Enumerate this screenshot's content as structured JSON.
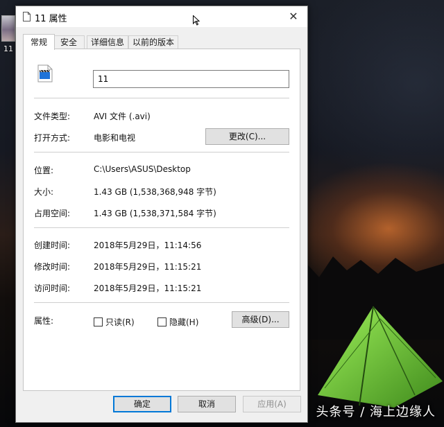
{
  "desktop": {
    "file_label": "11",
    "watermark": "头条号 / 海上边缘人"
  },
  "window": {
    "title": "11 属性",
    "tabs": [
      {
        "label": "常规",
        "active": true
      },
      {
        "label": "安全",
        "active": false
      },
      {
        "label": "详细信息",
        "active": false
      },
      {
        "label": "以前的版本",
        "active": false
      }
    ],
    "name_value": "11",
    "file_type": {
      "label": "文件类型:",
      "value": "AVI 文件 (.avi)"
    },
    "opens_with": {
      "label": "打开方式:",
      "value": "电影和电视",
      "button": "更改(C)..."
    },
    "location": {
      "label": "位置:",
      "value": "C:\\Users\\ASUS\\Desktop"
    },
    "size": {
      "label": "大小:",
      "value": "1.43 GB (1,538,368,948 字节)"
    },
    "size_on_disk": {
      "label": "占用空间:",
      "value": "1.43 GB (1,538,371,584 字节)"
    },
    "created": {
      "label": "创建时间:",
      "value": "2018年5月29日，11:14:56"
    },
    "modified": {
      "label": "修改时间:",
      "value": "2018年5月29日，11:15:21"
    },
    "accessed": {
      "label": "访问时间:",
      "value": "2018年5月29日，11:15:21"
    },
    "attributes": {
      "label": "属性:",
      "readonly": {
        "label": "只读(R)",
        "checked": false
      },
      "hidden": {
        "label": "隐藏(H)",
        "checked": false
      },
      "advanced_button": "高级(D)..."
    },
    "footer": {
      "ok": "确定",
      "cancel": "取消",
      "apply": "应用(A)"
    }
  },
  "colors": {
    "accent": "#0078d7",
    "tent": "#7bd83a"
  }
}
